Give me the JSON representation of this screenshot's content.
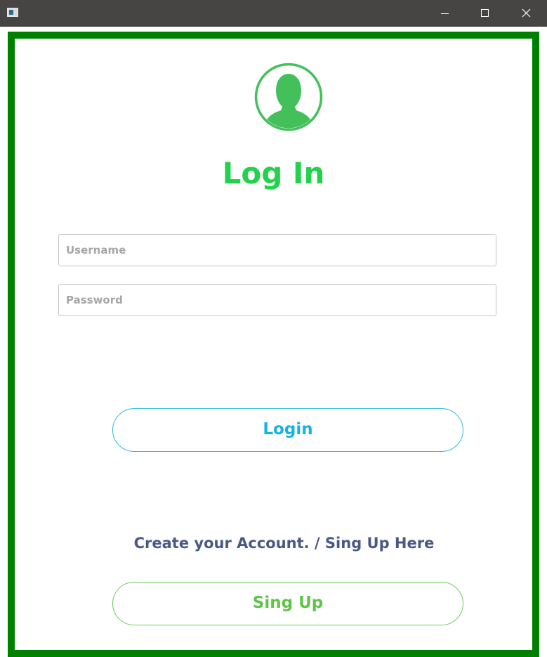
{
  "window": {
    "controls": {
      "minimize_icon": "minimize-icon",
      "maximize_icon": "maximize-icon",
      "close_icon": "close-icon"
    }
  },
  "colors": {
    "frame": "#008000",
    "title": "#21d24b",
    "login_accent": "#17b2e4",
    "signup_accent": "#5fc448",
    "link_text": "#4a5888",
    "avatar": "#44c05a"
  },
  "login": {
    "title": "Log In",
    "username_placeholder": "Username",
    "username_value": "",
    "password_placeholder": "Password",
    "password_value": "",
    "login_label": "Login",
    "create_account_text": "Create your Account. / Sing Up Here",
    "signup_label": "Sing Up"
  }
}
